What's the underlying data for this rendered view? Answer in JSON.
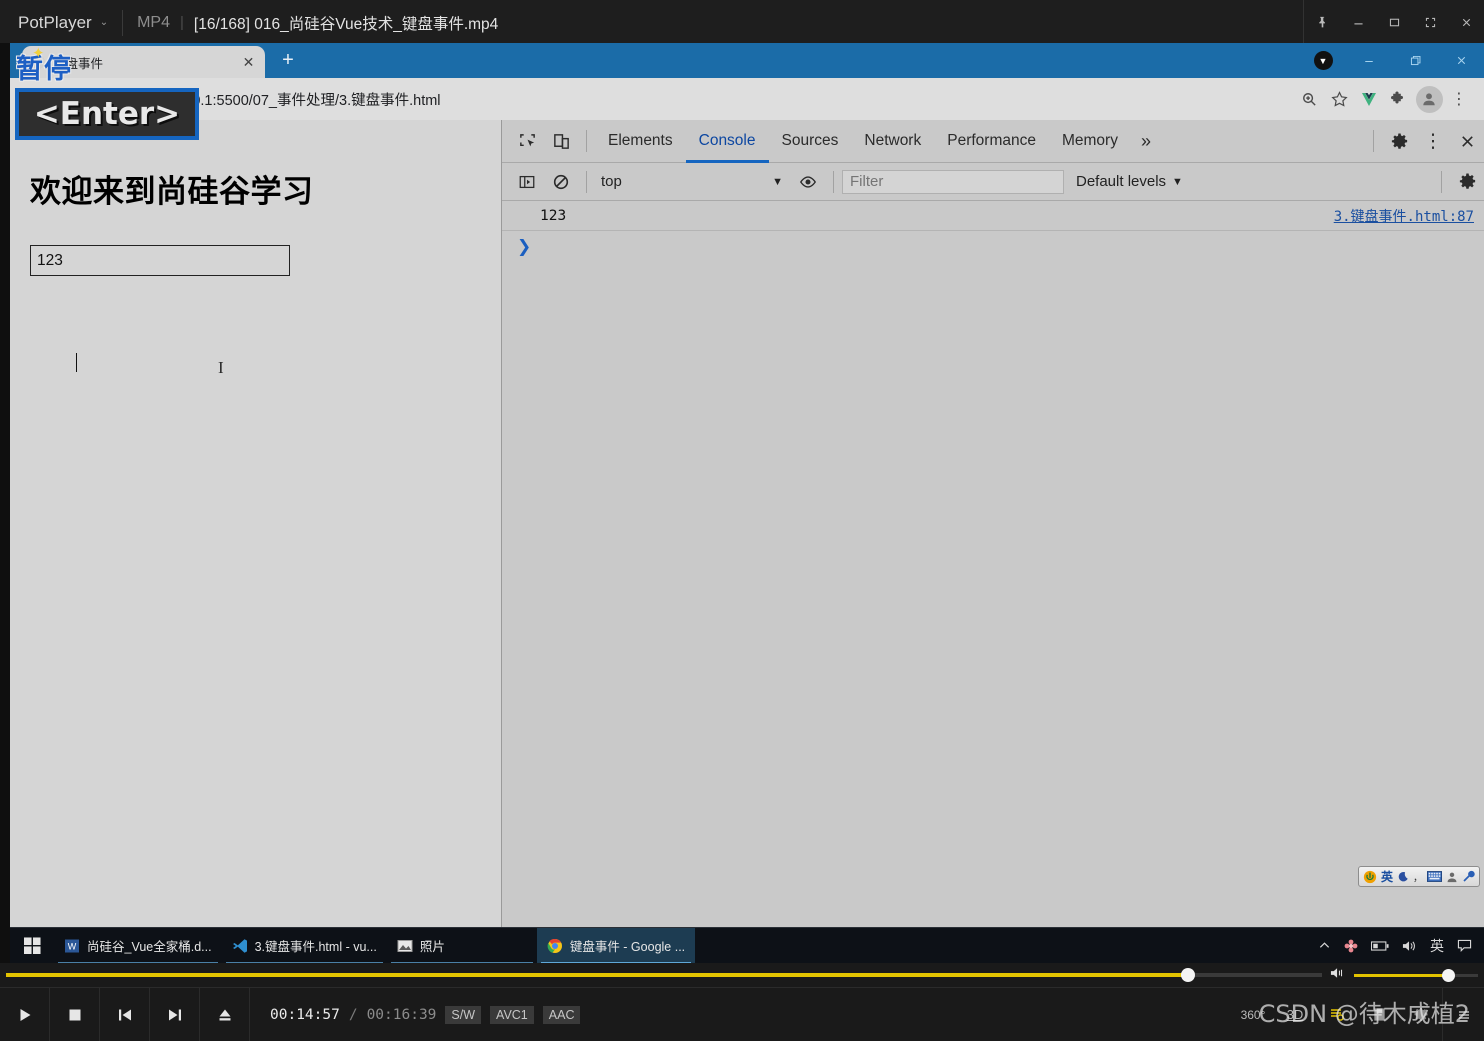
{
  "player": {
    "brand": "PotPlayer",
    "caret": "⌄",
    "media_type": "MP4",
    "separator": "|",
    "filename": "[16/168] 016_尚硅谷Vue技术_键盘事件.mp4",
    "window_buttons": [
      {
        "name": "pin-button",
        "glyph": "📌"
      },
      {
        "name": "minimize-button",
        "glyph": "—"
      },
      {
        "name": "maximize-button",
        "glyph": "□"
      },
      {
        "name": "fullscreen-button",
        "glyph": "⛶"
      },
      {
        "name": "close-button",
        "glyph": "✕"
      }
    ],
    "seek": {
      "position_pct": 89.8,
      "handle_pct": 89.8
    },
    "volume": {
      "level_pct": 76
    },
    "controls": [
      {
        "name": "play-button",
        "glyph": "▶"
      },
      {
        "name": "stop-button",
        "glyph": "■"
      },
      {
        "name": "previous-button",
        "glyph": "⏮"
      },
      {
        "name": "next-button",
        "glyph": "⏭"
      },
      {
        "name": "eject-button",
        "glyph": "⏏"
      }
    ],
    "time_current": "00:14:57",
    "time_slash": "/",
    "time_total": "00:16:39",
    "codecs": [
      "S/W",
      "AVC1",
      "AAC"
    ],
    "right_buttons": [
      {
        "name": "view360-button",
        "label": "360°"
      },
      {
        "name": "view3d-button",
        "label": "3D"
      },
      {
        "name": "playlist-button",
        "label": "☰"
      },
      {
        "name": "bookmark-button",
        "label": "🔖"
      },
      {
        "name": "settings-button",
        "label": "⚙"
      },
      {
        "name": "menu-button",
        "label": "≡"
      }
    ]
  },
  "osd": {
    "pause_text": "暂停",
    "key_text": "<Enter>"
  },
  "watermark": "CSDN @待木成植2",
  "browser": {
    "tab": {
      "title": "键盘事件",
      "close_glyph": "✕"
    },
    "new_tab_glyph": "+",
    "window_controls": [
      {
        "name": "download-indicator",
        "glyph": "▼"
      },
      {
        "name": "minimize-button",
        "glyph": "—"
      },
      {
        "name": "restore-button",
        "glyph": "❐"
      },
      {
        "name": "close-button",
        "glyph": "✕"
      }
    ],
    "nav": {
      "back_glyph": "←",
      "forward_glyph": "→",
      "reload_glyph": "⟳"
    },
    "omnibox": {
      "info_glyph": "i",
      "url": "127.0.0.1:5500/07_事件处理/3.键盘事件.html"
    },
    "toolbar_icons": [
      {
        "name": "zoom-icon",
        "glyph": "⊕"
      },
      {
        "name": "bookmark-star-icon",
        "glyph": "☆"
      },
      {
        "name": "vue-devtools-icon",
        "glyph": "V"
      },
      {
        "name": "extensions-puzzle-icon",
        "glyph": "🧩"
      },
      {
        "name": "profile-avatar-icon",
        "glyph": "👤"
      },
      {
        "name": "chrome-menu-icon",
        "glyph": "⋮"
      }
    ]
  },
  "page": {
    "heading": "欢迎来到尚硅谷学习",
    "input_value": "123",
    "input_placeholder": ""
  },
  "devtools": {
    "left_icons": [
      {
        "name": "inspect-element-icon",
        "glyph": "⬚"
      },
      {
        "name": "device-toolbar-icon",
        "glyph": "▯"
      }
    ],
    "tabs": [
      {
        "name": "tab-elements",
        "label": "Elements",
        "active": false
      },
      {
        "name": "tab-console",
        "label": "Console",
        "active": true
      },
      {
        "name": "tab-sources",
        "label": "Sources",
        "active": false
      },
      {
        "name": "tab-network",
        "label": "Network",
        "active": false
      },
      {
        "name": "tab-performance",
        "label": "Performance",
        "active": false
      },
      {
        "name": "tab-memory",
        "label": "Memory",
        "active": false
      }
    ],
    "more_tabs_glyph": "»",
    "right_icons": [
      {
        "name": "devtools-settings-gear-icon",
        "glyph": "⚙"
      },
      {
        "name": "devtools-more-options-icon",
        "glyph": "⋮"
      },
      {
        "name": "devtools-close-icon",
        "glyph": "✕"
      }
    ],
    "console_toolbar": {
      "sidebar_toggle_glyph": "▶|",
      "clear_console_glyph": "⃠",
      "context": "top",
      "context_caret": "▼",
      "eye_glyph": "◉",
      "filter_placeholder": "Filter",
      "filter_value": "",
      "levels_label": "Default levels",
      "levels_caret": "▼",
      "settings_gear_glyph": "⚙"
    },
    "console_messages": [
      {
        "text": "123",
        "source": "3.键盘事件.html:87"
      }
    ],
    "prompt_glyph": "❯"
  },
  "ime_bar": {
    "items": [
      {
        "name": "sogou-logo-icon",
        "glyph": "U"
      },
      {
        "name": "ime-language-label",
        "glyph": "英"
      },
      {
        "name": "ime-moon-icon",
        "glyph": "🌙"
      },
      {
        "name": "ime-punctuation-icon",
        "glyph": "，"
      },
      {
        "name": "ime-keyboard-icon",
        "glyph": "⌨"
      },
      {
        "name": "ime-user-icon",
        "glyph": "👤"
      },
      {
        "name": "ime-toolbox-icon",
        "glyph": "🔧"
      }
    ]
  },
  "taskbar": {
    "start_glyph": "⊞",
    "items": [
      {
        "name": "taskbar-item-word",
        "label": "尚硅谷_Vue全家桶.d...",
        "icon": "word-icon",
        "active": false
      },
      {
        "name": "taskbar-item-vscode",
        "label": "3.键盘事件.html - vu...",
        "icon": "vscode-icon",
        "active": false
      },
      {
        "name": "taskbar-item-photos",
        "label": "照片",
        "icon": "photos-icon",
        "active": false
      },
      {
        "name": "taskbar-item-chrome",
        "label": "键盘事件 - Google ...",
        "icon": "chrome-icon",
        "active": true
      }
    ],
    "tray": [
      {
        "name": "tray-chevron-up-icon",
        "glyph": "︿"
      },
      {
        "name": "tray-app-flower-icon",
        "glyph": "❀"
      },
      {
        "name": "tray-battery-icon",
        "glyph": "🔋"
      },
      {
        "name": "tray-volume-icon",
        "glyph": "🔊"
      },
      {
        "name": "tray-ime-label",
        "glyph": "英"
      },
      {
        "name": "tray-notifications-icon",
        "glyph": "🗨"
      }
    ]
  }
}
